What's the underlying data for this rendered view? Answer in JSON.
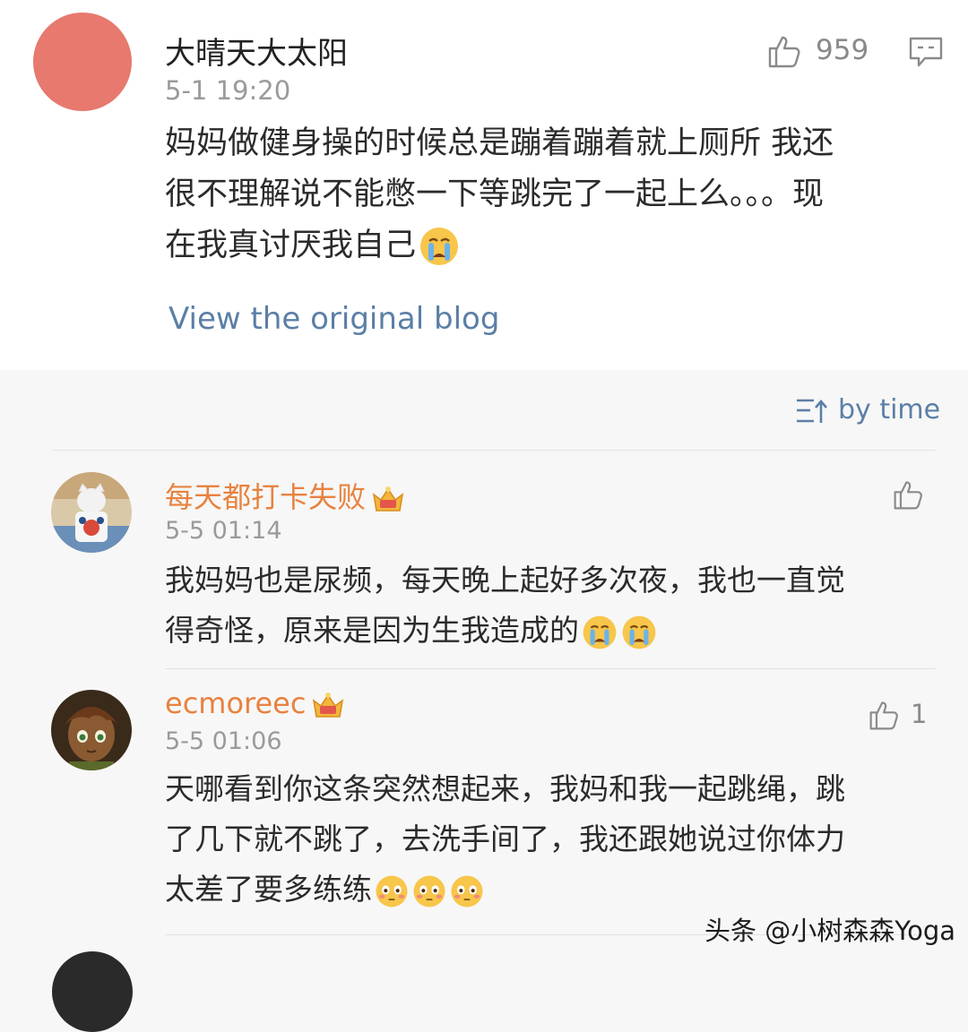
{
  "original_post": {
    "author": "大晴天大太阳",
    "time": "5-1 19:20",
    "like_count": "959",
    "avatar_color": "#e7796e",
    "text_lines": [
      "妈妈做健身操的时候总是蹦着蹦着就上厕所 我还",
      "很不理解说不能憋一下等跳完了一起上么。。。现",
      "在我真讨厌我自己"
    ],
    "emoji": "crying-face-emoji",
    "view_link": "View the original blog"
  },
  "sort": {
    "label": "by time",
    "icon": "sort-icon"
  },
  "comments": [
    {
      "author": "每天都打卡失败",
      "badge": "crown-badge-icon",
      "time": "5-5 01:14",
      "like_count": "",
      "text_lines": [
        "我妈妈也是尿频，每天晚上起好多次夜，我也一直觉",
        "得奇怪，原来是因为生我造成的"
      ],
      "emojis": [
        "crying-face-emoji",
        "crying-face-emoji"
      ]
    },
    {
      "author": "ecmoreec",
      "badge": "crown-badge-icon",
      "time": "5-5 01:06",
      "like_count": "1",
      "text_lines": [
        "天哪看到你这条突然想起来，我妈和我一起跳绳，跳",
        "了几下就不跳了，去洗手间了，我还跟她说过你体力",
        "太差了要多练练"
      ],
      "emojis": [
        "flushed-face-emoji",
        "flushed-face-emoji",
        "flushed-face-emoji"
      ]
    }
  ],
  "watermark": "头条 @小树森森Yoga",
  "colors": {
    "link": "#5b7fa6",
    "username": "#e8823f",
    "meta": "#9a9a9a",
    "background": "#f7f7f7"
  }
}
